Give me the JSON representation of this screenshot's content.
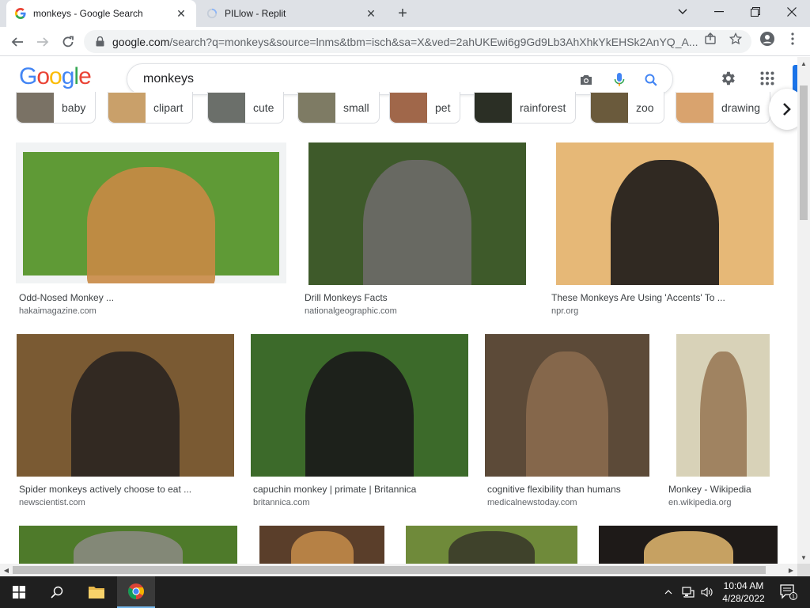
{
  "browser": {
    "tabs": [
      {
        "title": "monkeys - Google Search",
        "favicon": "google-g-icon",
        "active": true
      },
      {
        "title": "PILlow - Replit",
        "favicon": "loading-spinner-icon",
        "active": false
      }
    ],
    "address": {
      "host": "google.com",
      "path": "/search?q=monkeys&source=lnms&tbm=isch&sa=X&ved=2ahUKEwi6g9Gd9Lb3AhXhkYkEHSk2AnYQ_A..."
    }
  },
  "google": {
    "logo_letters": [
      {
        "ch": "G",
        "color": "#4285F4"
      },
      {
        "ch": "o",
        "color": "#EA4335"
      },
      {
        "ch": "o",
        "color": "#FBBC05"
      },
      {
        "ch": "g",
        "color": "#4285F4"
      },
      {
        "ch": "l",
        "color": "#34A853"
      },
      {
        "ch": "e",
        "color": "#EA4335"
      }
    ],
    "query": "monkeys"
  },
  "chips": [
    {
      "label": "baby",
      "color": "#7a7265"
    },
    {
      "label": "clipart",
      "color": "#c9a06a"
    },
    {
      "label": "cute",
      "color": "#6b6f6a"
    },
    {
      "label": "small",
      "color": "#7e7b64"
    },
    {
      "label": "pet",
      "color": "#a0674a"
    },
    {
      "label": "rainforest",
      "color": "#2b2f25"
    },
    {
      "label": "zoo",
      "color": "#6a5a3c"
    },
    {
      "label": "drawing",
      "color": "#d9a36e"
    }
  ],
  "results": [
    {
      "caption": "Odd-Nosed Monkey ...",
      "source": "hakaimagazine.com",
      "bg": "#5f9a36",
      "subject": "#c98a45"
    },
    {
      "caption": "Drill Monkeys Facts",
      "source": "nationalgeographic.com",
      "bg": "#3e5a2a",
      "subject": "#6d6a68"
    },
    {
      "caption": "These Monkeys Are Using 'Accents' To ...",
      "source": "npr.org",
      "bg": "#e6b877",
      "subject": "#1c1a18"
    },
    {
      "caption": "Spider monkeys actively choose to eat ...",
      "source": "newscientist.com",
      "bg": "#7a5a33",
      "subject": "#2a2320"
    },
    {
      "caption": "capuchin monkey | primate | Britannica",
      "source": "britannica.com",
      "bg": "#3c6a2a",
      "subject": "#1a1a1a"
    },
    {
      "caption": "cognitive flexibility than humans",
      "source": "medicalnewstoday.com",
      "bg": "#5c4a38",
      "subject": "#8a6a4e"
    },
    {
      "caption": "Monkey - Wikipedia",
      "source": "en.wikipedia.org",
      "bg": "#d8d2b8",
      "subject": "#9a7a58"
    },
    {
      "caption": "",
      "source": "",
      "bg": "#4e7a2a",
      "subject": "#8a8a80"
    },
    {
      "caption": "",
      "source": "",
      "bg": "#5a3e2a",
      "subject": "#c08848"
    },
    {
      "caption": "",
      "source": "",
      "bg": "#6f8a3a",
      "subject": "#3a3a2a"
    },
    {
      "caption": "",
      "source": "",
      "bg": "#1e1a18",
      "subject": "#d8b06a"
    }
  ],
  "taskbar": {
    "time": "10:04 AM",
    "date": "4/28/2022",
    "notifications": "1"
  }
}
